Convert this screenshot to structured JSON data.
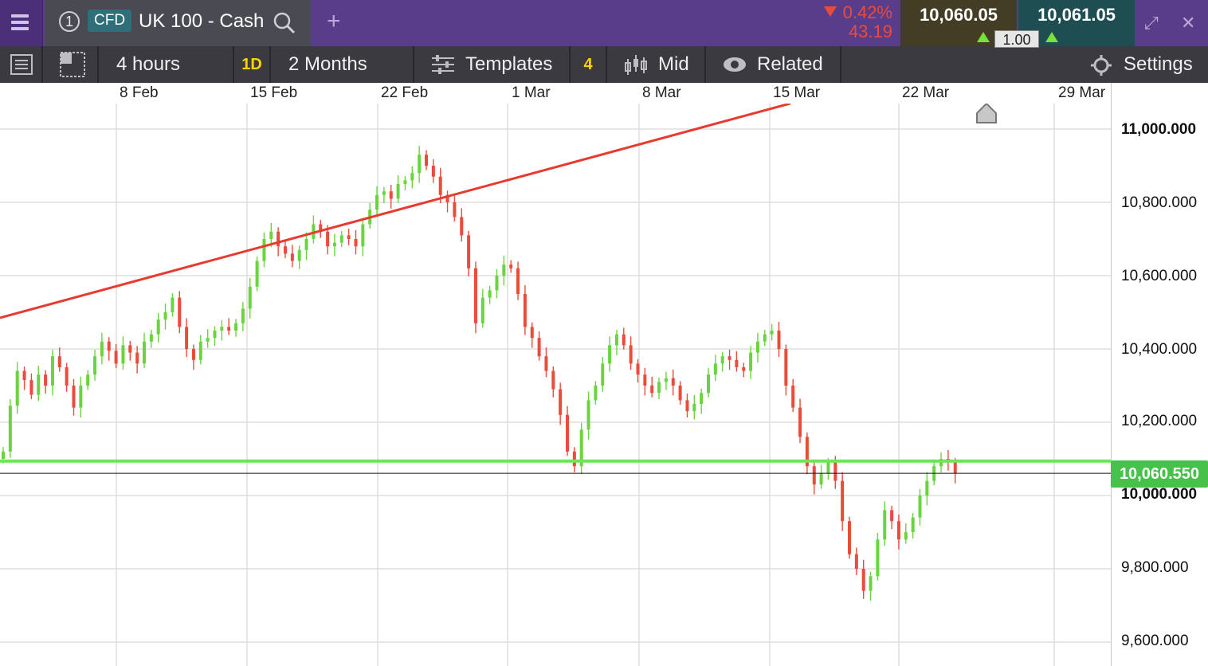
{
  "topbar": {
    "menu_icon": "hamburger-icon",
    "instrument_number": "1",
    "instrument_type": "CFD",
    "instrument_name": "UK 100 - Cash",
    "change_percent": "0.42%",
    "change_points": "43.19",
    "sell_price": "10,060.05",
    "buy_price": "10,061.05",
    "spread": "1.00",
    "colors": {
      "header": "#5a3d8a",
      "down": "#e84c3d",
      "up": "#7be03a"
    }
  },
  "toolbar": {
    "interval": "4 hours",
    "interval_badge": "1D",
    "range": "2 Months",
    "templates_label": "Templates",
    "templates_count": "4",
    "price_mode": "Mid",
    "related_label": "Related",
    "settings_label": "Settings"
  },
  "chart_data": {
    "type": "candlestick",
    "x_labels": [
      "8 Feb",
      "15 Feb",
      "22 Feb",
      "1 Mar",
      "8 Mar",
      "15 Mar",
      "22 Mar",
      "29 Mar"
    ],
    "y_ticks": [
      "11,000.000",
      "10,800.000",
      "10,600.000",
      "10,400.000",
      "10,200.000",
      "10,000.000",
      "9,800.000",
      "9,600.000"
    ],
    "y_tick_values": [
      11000,
      10800,
      10600,
      10400,
      10200,
      10000,
      9800,
      9600
    ],
    "current_price": "10,060.550",
    "current_price_value": 10060.55,
    "support_line_value": 10094,
    "trendline": {
      "from": [
        "1 Feb",
        10485
      ],
      "to": [
        "16 Mar",
        11070
      ]
    },
    "closes": [
      10120,
      10245,
      10340,
      10315,
      10275,
      10330,
      10300,
      10380,
      10350,
      10300,
      10240,
      10300,
      10330,
      10380,
      10420,
      10395,
      10360,
      10410,
      10390,
      10360,
      10420,
      10440,
      10480,
      10500,
      10540,
      10460,
      10400,
      10370,
      10420,
      10430,
      10450,
      10460,
      10450,
      10470,
      10510,
      10570,
      10640,
      10700,
      10720,
      10680,
      10660,
      10640,
      10670,
      10700,
      10740,
      10720,
      10680,
      10690,
      10710,
      10700,
      10680,
      10740,
      10780,
      10820,
      10830,
      10810,
      10850,
      10860,
      10880,
      10930,
      10900,
      10870,
      10820,
      10800,
      10760,
      10710,
      10620,
      10470,
      10540,
      10560,
      10600,
      10630,
      10620,
      10550,
      10460,
      10430,
      10380,
      10340,
      10290,
      10220,
      10120,
      10080,
      10180,
      10260,
      10300,
      10360,
      10410,
      10440,
      10410,
      10360,
      10330,
      10300,
      10280,
      10310,
      10320,
      10300,
      10260,
      10230,
      10250,
      10280,
      10330,
      10360,
      10380,
      10370,
      10350,
      10340,
      10390,
      10420,
      10440,
      10450,
      10400,
      10300,
      10240,
      10160,
      10080,
      10030,
      10060,
      10090,
      10040,
      9930,
      9840,
      9800,
      9740,
      9780,
      9880,
      9960,
      9930,
      9880,
      9900,
      9940,
      10000,
      10040,
      10080,
      10100,
      10090,
      10060
    ]
  }
}
